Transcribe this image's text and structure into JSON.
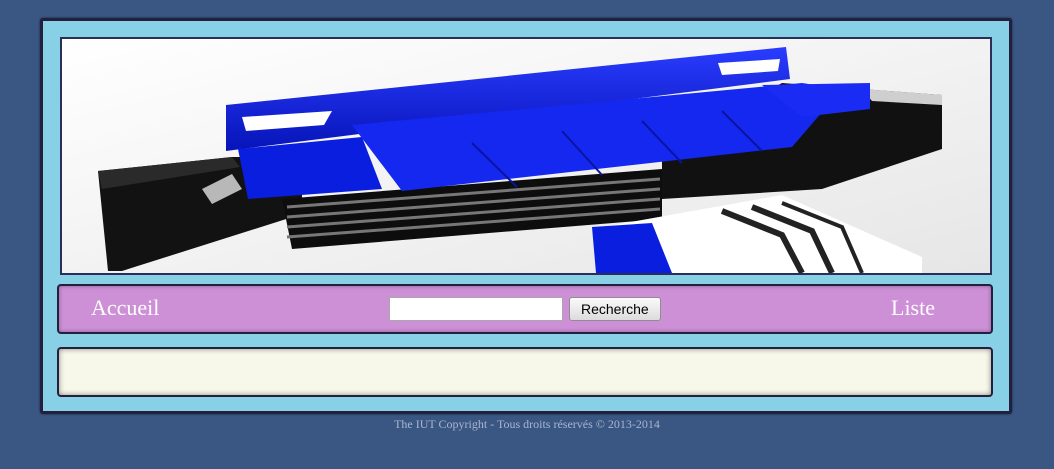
{
  "nav": {
    "home_label": "Accueil",
    "list_label": "Liste",
    "search_placeholder": "",
    "search_value": "",
    "search_button_label": "Recherche"
  },
  "banner": {
    "image": "sofa-banner-icon"
  },
  "content": {
    "text": ""
  },
  "footer": {
    "copyright": "The IUT Copyright - Tous droits réservés © 2013-2014"
  },
  "colors": {
    "page_bg": "#3a5683",
    "frame_bg": "#88d0e6",
    "nav_bg": "#cd90d6",
    "content_bg": "#f8f8ea",
    "sofa_blue": "#0a1ee0"
  }
}
